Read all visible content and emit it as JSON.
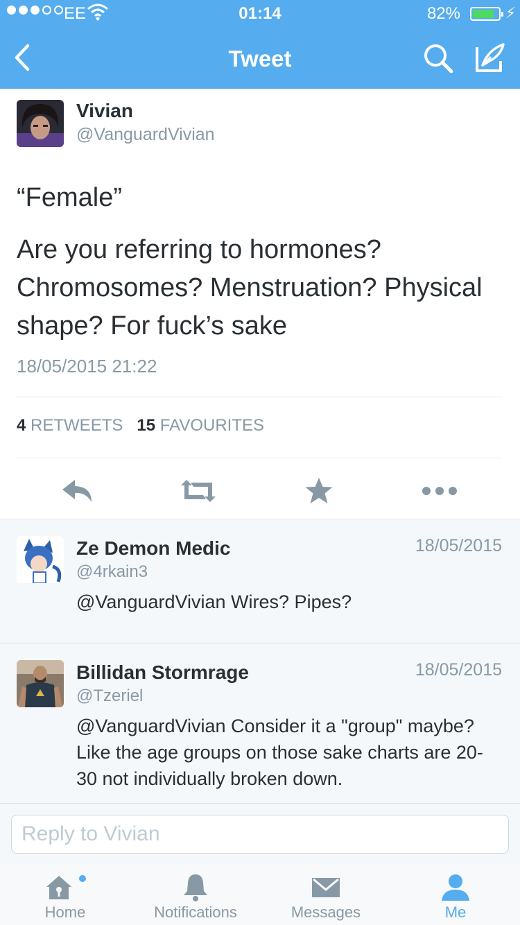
{
  "status_bar": {
    "carrier": "EE",
    "time": "01:14",
    "battery_percent": "82%",
    "battery_level": 0.82,
    "signal_dots_filled": 3,
    "signal_dots_total": 5
  },
  "nav": {
    "title": "Tweet",
    "back_icon": "chevron-left-icon",
    "search_icon": "search-icon",
    "compose_icon": "compose-icon"
  },
  "tweet": {
    "author_name": "Vivian",
    "author_handle": "@VanguardVivian",
    "text_quote": "“Female”",
    "text_body": "Are you referring to hormones? Chromosomes? Menstruation? Physical shape? For fuck’s sake",
    "timestamp": "18/05/2015 21:22",
    "retweets_count": "4",
    "retweets_label": "RETWEETS",
    "favourites_count": "15",
    "favourites_label": "FAVOURITES"
  },
  "replies": [
    {
      "name": "Ze Demon Medic",
      "handle": "@4rkain3",
      "date": "18/05/2015",
      "text": "@VanguardVivian Wires? Pipes?"
    },
    {
      "name": "Billidan Stormrage",
      "handle": "@Tzeriel",
      "date": "18/05/2015",
      "text": "@VanguardVivian Consider it a \"group\" maybe? Like the age groups on those sake charts are 20-30 not individually broken down."
    }
  ],
  "reply_box": {
    "placeholder": "Reply to Vivian"
  },
  "tabs": [
    {
      "label": "Home",
      "icon": "home-icon",
      "active": false,
      "has_notification_dot": true
    },
    {
      "label": "Notifications",
      "icon": "bell-icon",
      "active": false
    },
    {
      "label": "Messages",
      "icon": "envelope-icon",
      "active": false
    },
    {
      "label": "Me",
      "icon": "person-icon",
      "active": true
    }
  ],
  "colors": {
    "brand": "#55acee",
    "text_primary": "#292f33",
    "text_secondary": "#8899a6",
    "battery_fill": "#4cd964",
    "action_icon": "#8899a6"
  }
}
